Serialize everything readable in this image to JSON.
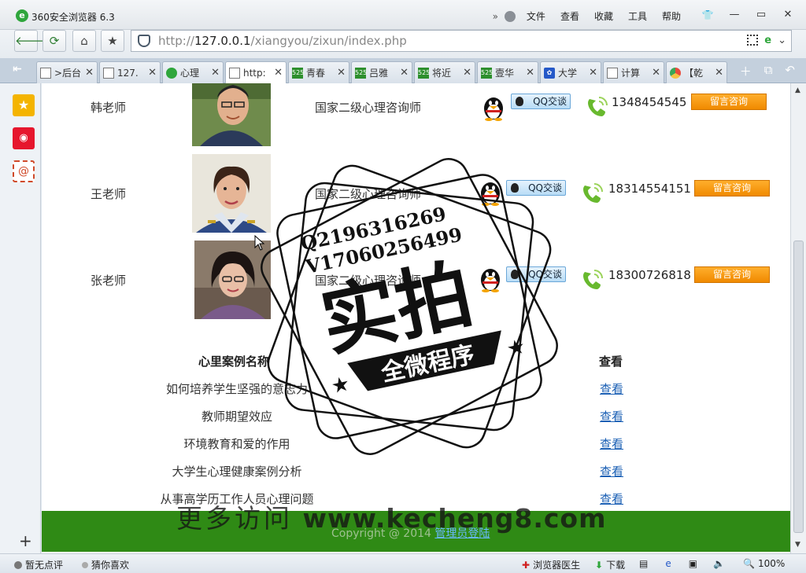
{
  "browser": {
    "title": "360安全浏览器 6.3",
    "menu": [
      "文件",
      "查看",
      "收藏",
      "工具",
      "帮助"
    ],
    "url_prefix": "http://",
    "url_host": "127.0.0.1",
    "url_path": "/xiangyou/zixun/index.php"
  },
  "tabs": [
    {
      "label": ">后台",
      "icon": "page"
    },
    {
      "label": "127.",
      "icon": "page"
    },
    {
      "label": "心理",
      "icon": "round"
    },
    {
      "label": "http:",
      "icon": "page",
      "active": true
    },
    {
      "label": "青春",
      "icon": "g525"
    },
    {
      "label": "吕雅",
      "icon": "g525"
    },
    {
      "label": "将近",
      "icon": "g525"
    },
    {
      "label": "壹华",
      "icon": "g525"
    },
    {
      "label": "大学",
      "icon": "paw"
    },
    {
      "label": "计算",
      "icon": "page"
    },
    {
      "label": "【乾",
      "icon": "chrome"
    }
  ],
  "teachers": [
    {
      "name": "韩老师",
      "title": "国家二级心理咨询师",
      "qq_label": "QQ交谈",
      "phone": "1348454545",
      "message_label": "留言咨询"
    },
    {
      "name": "王老师",
      "title": "国家二级心理咨询师",
      "qq_label": "QQ交谈",
      "phone": "18314554151",
      "message_label": "留言咨询"
    },
    {
      "name": "张老师",
      "title": "国家二级心理咨询师",
      "qq_label": "QQ交谈",
      "phone": "18300726818",
      "message_label": "留言咨询"
    }
  ],
  "cases": {
    "header_name": "心里案例名称",
    "header_view": "查看",
    "items": [
      {
        "title": "如何培养学生坚强的意志力",
        "link": "查看"
      },
      {
        "title": "教师期望效应",
        "link": "查看"
      },
      {
        "title": "环境教育和爱的作用",
        "link": "查看"
      },
      {
        "title": "大学生心理健康案例分析",
        "link": "查看"
      },
      {
        "title": "从事高学历工作人员心理问题",
        "link": "查看"
      }
    ]
  },
  "footer": {
    "copyright": "Copyright @ 2014",
    "admin_link": "管理员登陆"
  },
  "statusbar": {
    "rating": "暂无点评",
    "guess": "猜你喜欢",
    "doctor": "浏览器医生",
    "download": "下载",
    "zoom": "100%"
  },
  "watermark": {
    "line1": "Q2196316269",
    "line2": "V17060256499",
    "main": "实拍",
    "banner": "全微程序",
    "url_cn": "更多访问",
    "url": "www.kecheng8.com"
  }
}
